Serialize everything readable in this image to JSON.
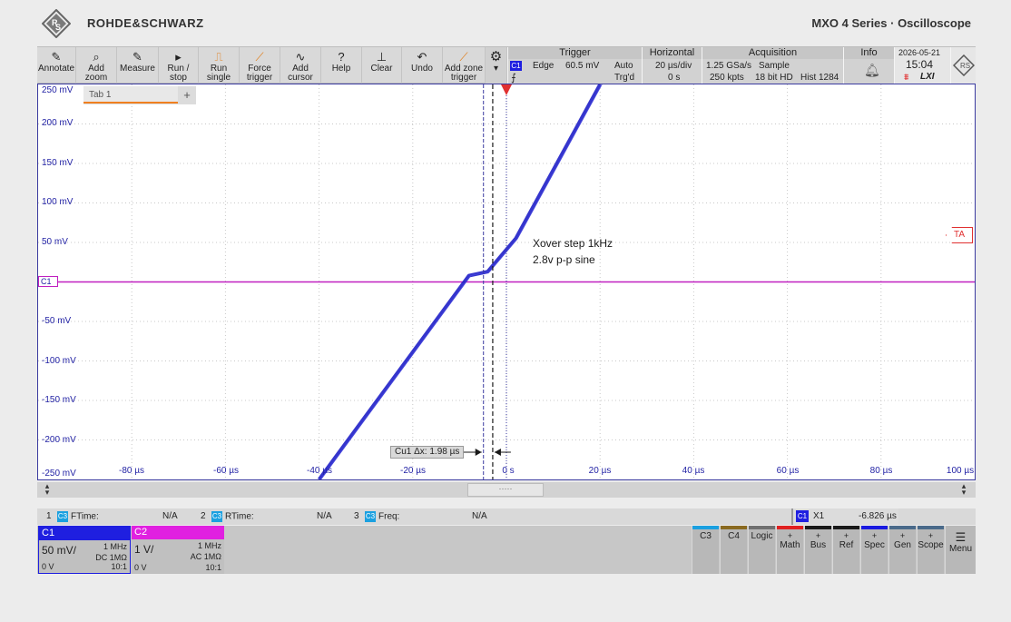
{
  "header": {
    "brand": "ROHDE&SCHWARZ",
    "product": "MXO 4 Series · Oscilloscope"
  },
  "toolbar": {
    "buttons": [
      {
        "label": "Annotate",
        "icon": "✎"
      },
      {
        "label": "Add\nzoom",
        "icon": "🔍"
      },
      {
        "label": "Measure",
        "icon": "✎"
      },
      {
        "label": "Run /\nstop",
        "icon": "▸"
      },
      {
        "label": "Run\nsingle",
        "icon": "⌇"
      },
      {
        "label": "Force\ntrigger",
        "icon": "⌇"
      },
      {
        "label": "Add\ncursor",
        "icon": "∿"
      },
      {
        "label": "Help",
        "icon": "?"
      },
      {
        "label": "Clear",
        "icon": "⊥"
      },
      {
        "label": "Undo",
        "icon": "↶"
      },
      {
        "label": "Add zone\ntrigger",
        "icon": "⌇"
      }
    ]
  },
  "trigger": {
    "title": "Trigger",
    "source": "C1",
    "type": "Edge",
    "level": "60.5 mV",
    "mode": "Auto",
    "status": "Trg'd"
  },
  "horizontal": {
    "title": "Horizontal",
    "timebase": "20 µs/div",
    "position": "0 s"
  },
  "acquisition": {
    "title": "Acquisition",
    "sample_rate": "1.25 GSa/s",
    "mode": "Sample",
    "record_length": "250 kpts",
    "resolution": "18 bit HD",
    "hist": "Hist 1284"
  },
  "info": {
    "title": "Info",
    "date": "2026-05-21",
    "time": "15:04",
    "lxi": "LXI"
  },
  "plot": {
    "tab_label": "Tab 1",
    "tab_add": "+",
    "y_labels": [
      "250 mV",
      "200 mV",
      "150 mV",
      "100 mV",
      "50 mV",
      "-50 mV",
      "-100 mV",
      "-150 mV",
      "-200 mV",
      "-250 mV"
    ],
    "x_labels": [
      "-80 µs",
      "-60 µs",
      "-40 µs",
      "-20 µs",
      "0 s",
      "20 µs",
      "40 µs",
      "60 µs",
      "80 µs",
      "100 µs"
    ],
    "note_line1": "Xover step 1kHz",
    "note_line2": "2.8v p-p sine",
    "cursor_label": "Cu1 Δx: 1.98 µs",
    "ch_marker": "C1",
    "trigger_marker": "TA",
    "y_unit_min_mv": -250,
    "y_unit_max_mv": 250,
    "trigger_level_mv": 60.5,
    "trace": {
      "color": "#1f1fc8",
      "points_us_mv": [
        [
          -40,
          -250
        ],
        [
          -8,
          8
        ],
        [
          -4,
          13
        ],
        [
          2,
          55
        ],
        [
          20,
          250
        ]
      ]
    },
    "cursor_x_us": -4.9,
    "cursor_dx_us": 1.98
  },
  "measurements": {
    "m1_index": "1",
    "m1_chip": "C3",
    "m1_name": "FTime:",
    "m1_value": "N/A",
    "m2_index": "2",
    "m2_chip": "C3",
    "m2_name": "RTime:",
    "m2_value": "N/A",
    "m3_index": "3",
    "m3_chip": "C3",
    "m3_name": "Freq:",
    "m3_value": "N/A",
    "x1_chip": "C1",
    "x1_label": "X1",
    "x1_value": "-6.826 µs"
  },
  "channels": [
    {
      "name": "C1",
      "scale": "50 mV/",
      "bw": "1 MHz",
      "coupling": "DC 1MΩ",
      "offset": "0 V",
      "probe": "10:1",
      "color": "#1f1fe0"
    },
    {
      "name": "C2",
      "scale": "1 V/",
      "bw": "1 MHz",
      "coupling": "AC 1MΩ",
      "offset": "0 V",
      "probe": "10:1",
      "color": "#e020e0"
    }
  ],
  "bottom_buttons": [
    {
      "label": "C3",
      "plus": "",
      "color": "#1aa0e0"
    },
    {
      "label": "C4",
      "plus": "",
      "color": "#8a6a20"
    },
    {
      "label": "Logic",
      "plus": "",
      "color": "#707070"
    },
    {
      "label": "Math",
      "plus": "+",
      "color": "#e02020"
    },
    {
      "label": "Bus",
      "plus": "+",
      "color": "#1a1a1a"
    },
    {
      "label": "Ref",
      "plus": "+",
      "color": "#1a1a1a"
    },
    {
      "label": "Spec",
      "plus": "+",
      "color": "#1a1ae0"
    },
    {
      "label": "Gen",
      "plus": "+",
      "color": "#4a6a8a"
    },
    {
      "label": "Scope",
      "plus": "+",
      "color": "#4a6a8a"
    },
    {
      "label": "Menu",
      "plus": "",
      "color": "#c7c7c7"
    }
  ]
}
